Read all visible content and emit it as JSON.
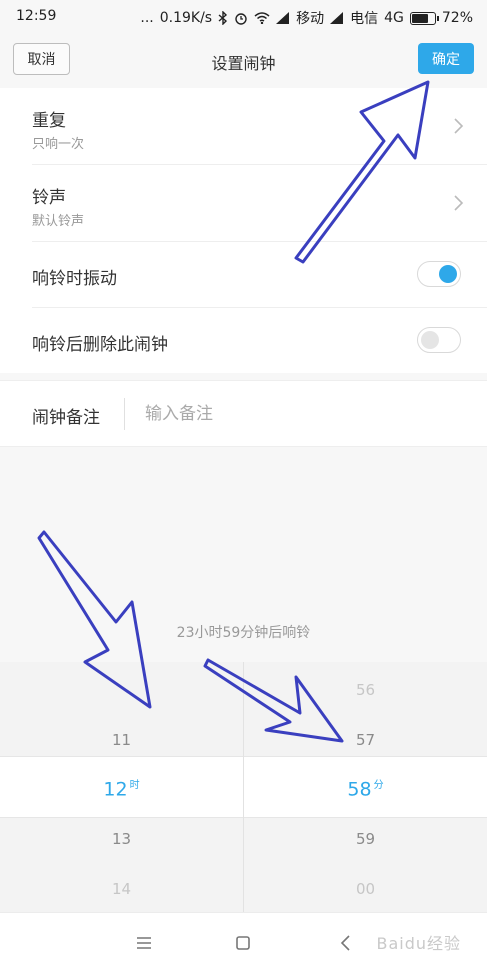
{
  "status_bar": {
    "time": "12:59",
    "dots": "...",
    "speed": "0.19K/s",
    "carrier1": "移动",
    "carrier2": "电信",
    "network": "4G",
    "battery": "72%"
  },
  "header": {
    "cancel_label": "取消",
    "title": "设置闹钟",
    "confirm_label": "确定"
  },
  "settings": {
    "repeat_title": "重复",
    "repeat_value": "只响一次",
    "ringtone_title": "铃声",
    "ringtone_value": "默认铃声",
    "vibrate_label": "响铃时振动",
    "vibrate_on": true,
    "delete_label": "响铃后删除此闹钟",
    "delete_on": false
  },
  "note": {
    "label": "闹钟备注",
    "placeholder": "输入备注"
  },
  "countdown": "23小时59分钟后响铃",
  "picker": {
    "hours": [
      "11",
      "12",
      "13",
      "14"
    ],
    "hour_selected": "12",
    "hour_unit": "时",
    "minutes": [
      "56",
      "57",
      "58",
      "59",
      "00"
    ],
    "minute_selected": "58",
    "minute_unit": "分"
  },
  "watermark": "Baidu经验",
  "colors": {
    "accent": "#2ea8e9",
    "annotation_arrow": "#3a3fbf"
  }
}
